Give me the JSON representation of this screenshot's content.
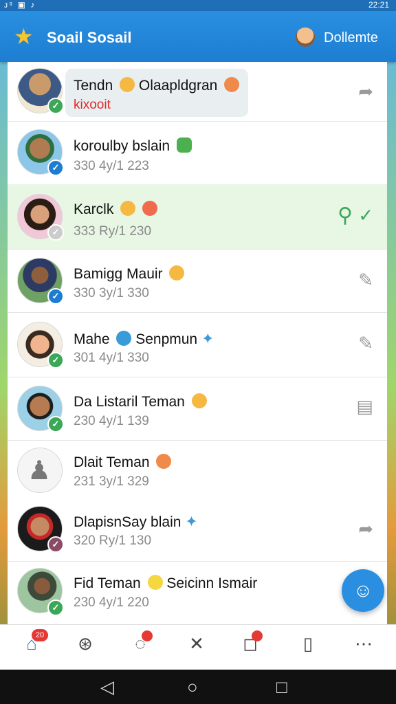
{
  "status_bar": {
    "left": "ᴊ⁹ ▣ ♪",
    "right": "22:21"
  },
  "app_bar": {
    "title": "Soail Sosail",
    "account": "Dollemte"
  },
  "contacts": [
    {
      "name": "Tendn",
      "name2": "Olaapldgran",
      "sub": "kixooit"
    },
    {
      "name": "koroulby bslain",
      "sub": "330 4y/1 223"
    },
    {
      "name": "Karclk",
      "sub": "333 Ry/1 230"
    },
    {
      "name": "Bamigg Mauir",
      "sub": "330 3y/1 330"
    },
    {
      "name": "Mahe",
      "name2": "Senpmun",
      "sub": "301 4y/1 330"
    },
    {
      "name": "Da Listaril Teman",
      "sub": "230 4y/1 139"
    },
    {
      "name": "Dlait Teman",
      "sub": "231 3y/1 329"
    },
    {
      "name": "DlapisnSay blain",
      "sub": "320 Ry/1 130"
    },
    {
      "name": "Fid Teman",
      "name2": "Seicinn Ismair",
      "sub": "230 4y/1 220"
    }
  ],
  "bottom_nav": {
    "home_badge": "20"
  },
  "icons": {
    "app": "star-icon",
    "fab": "chat-icon",
    "nav": [
      "home-icon",
      "contacts-icon",
      "messages-icon",
      "tools-icon",
      "notifications-icon",
      "phone-icon",
      "more-icon"
    ]
  },
  "colors": {
    "primary": "#1d7ed1",
    "accent_green": "#3aa856",
    "badge_red": "#e53935"
  }
}
